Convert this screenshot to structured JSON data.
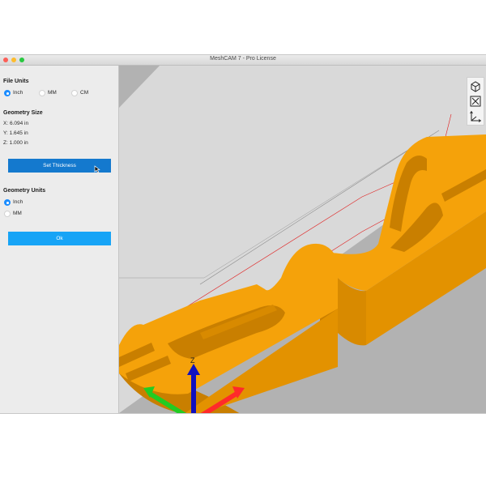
{
  "window": {
    "title": "MeshCAM 7 - Pro License",
    "traffic_colors": {
      "close": "#fc5f57",
      "minimize": "#fdbc2e",
      "zoom": "#28c840"
    }
  },
  "sidebar": {
    "file_units": {
      "heading": "File Units",
      "options": [
        {
          "label": "Inch",
          "selected": true
        },
        {
          "label": "MM",
          "selected": false
        },
        {
          "label": "CM",
          "selected": false
        }
      ]
    },
    "geometry_size": {
      "heading": "Geometry Size",
      "x": "X: 6.094 in",
      "y": "Y: 1.645 in",
      "z": "Z: 1.000 in"
    },
    "set_thickness_label": "Set Thickness",
    "geometry_units": {
      "heading": "Geometry Units",
      "options": [
        {
          "label": "Inch",
          "selected": true
        },
        {
          "label": "MM",
          "selected": false
        }
      ]
    },
    "ok_label": "Ok"
  },
  "viewport": {
    "axis_label": "Z",
    "colors": {
      "background": "#b2b2b2",
      "floor": "#d9d9d9",
      "part": "#f5a20a",
      "part_shade": "#c97f00",
      "axis_x": "#ff2a2a",
      "axis_y": "#22cc22",
      "axis_z": "#1010c0"
    },
    "tools": [
      "cube-view-icon",
      "fit-view-icon",
      "axes-icon"
    ]
  },
  "accent": "#1a8cff"
}
